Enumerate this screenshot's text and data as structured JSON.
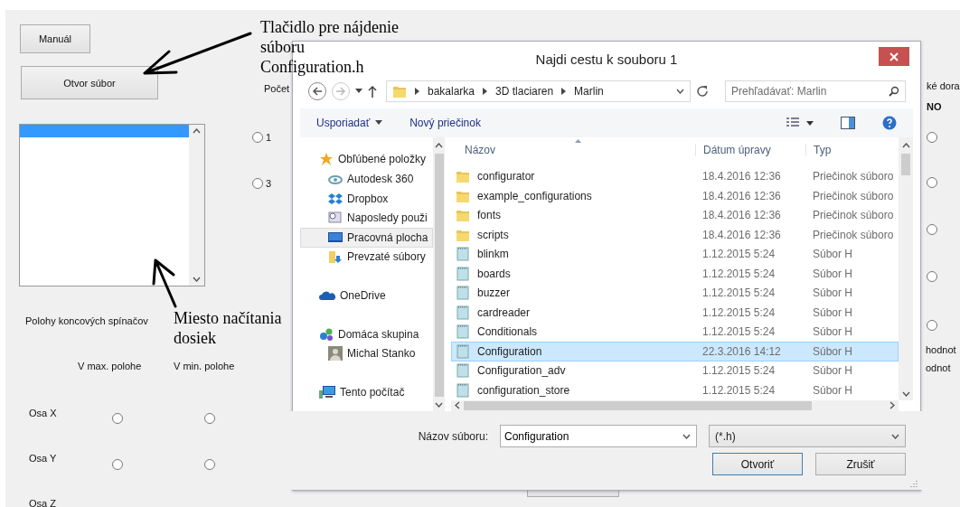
{
  "app": {
    "manual_button": "Manuál",
    "open_button": "Otvor súbor",
    "count_label": "Počet",
    "count_options": [
      {
        "label": "1",
        "selected": false
      },
      {
        "label": "3",
        "selected": false
      }
    ],
    "limit_title": "Polohy koncových spínačov",
    "limit_columns": [
      "V max. polohe",
      "V min. polohe"
    ],
    "axes": [
      {
        "label": "Osa X",
        "max_selected": false,
        "min_selected": false
      },
      {
        "label": "Osa Y",
        "max_selected": false,
        "min_selected": false
      },
      {
        "label": "Osa Z"
      }
    ],
    "right_heading": "ké dora",
    "right_column": "NO",
    "right_options": [
      {
        "selected": false
      },
      {
        "selected": false
      },
      {
        "selected": false
      },
      {
        "selected": false
      },
      {
        "selected": false
      }
    ],
    "right_labels": [
      "hodnot",
      "odnot"
    ]
  },
  "annotations": [
    {
      "lines": [
        "Tlačidlo pre nájdenie",
        "súboru",
        "Configuration.h"
      ]
    },
    {
      "lines": [
        "Miesto načítania",
        "dosiek"
      ]
    }
  ],
  "dialog": {
    "title": "Najdi cestu k souboru 1",
    "nav_buttons": [
      {
        "kind": "back",
        "disabled": false
      },
      {
        "kind": "forward",
        "disabled": true
      }
    ],
    "path": [
      "bakalarka",
      "3D tlaciaren",
      "Marlin"
    ],
    "search": {
      "placeholder": "Prehľadávať: Marlin"
    },
    "toolbar": [
      {
        "label": "Usporiadať",
        "dropdown": true
      },
      {
        "label": "Nový priečinok",
        "dropdown": false
      }
    ],
    "nav": [
      {
        "label": "Obľúbené položky",
        "kind": "favorites",
        "selected": false,
        "children": [
          {
            "label": "Autodesk 360",
            "kind": "cloud",
            "selected": false
          },
          {
            "label": "Dropbox",
            "kind": "box",
            "selected": false
          },
          {
            "label": "Naposledy použi",
            "kind": "recent",
            "selected": false
          },
          {
            "label": "Pracovná plocha",
            "kind": "desktop",
            "selected": true
          },
          {
            "label": "Prevzaté súbory",
            "kind": "downloads",
            "selected": false
          }
        ]
      },
      {
        "label": "OneDrive",
        "kind": "onedrive",
        "selected": false
      },
      {
        "label": "Domáca skupina",
        "kind": "homegroup",
        "selected": false,
        "children": [
          {
            "label": "Michal Stanko",
            "kind": "user",
            "selected": false
          }
        ]
      },
      {
        "label": "Tento počítač",
        "kind": "computer",
        "selected": false
      }
    ],
    "columns": [
      "Názov",
      "Dátum úpravy",
      "Typ"
    ],
    "files": [
      {
        "name": "configurator",
        "date": "18.4.2016 12:36",
        "type": "Priečinok súboro",
        "kind": "folder",
        "selected": false
      },
      {
        "name": "example_configurations",
        "date": "18.4.2016 12:36",
        "type": "Priečinok súboro",
        "kind": "folder",
        "selected": false
      },
      {
        "name": "fonts",
        "date": "18.4.2016 12:36",
        "type": "Priečinok súboro",
        "kind": "folder",
        "selected": false
      },
      {
        "name": "scripts",
        "date": "18.4.2016 12:36",
        "type": "Priečinok súboro",
        "kind": "folder",
        "selected": false
      },
      {
        "name": "blinkm",
        "date": "1.12.2015 5:24",
        "type": "Súbor H",
        "kind": "file",
        "selected": false
      },
      {
        "name": "boards",
        "date": "1.12.2015 5:24",
        "type": "Súbor H",
        "kind": "file",
        "selected": false
      },
      {
        "name": "buzzer",
        "date": "1.12.2015 5:24",
        "type": "Súbor H",
        "kind": "file",
        "selected": false
      },
      {
        "name": "cardreader",
        "date": "1.12.2015 5:24",
        "type": "Súbor H",
        "kind": "file",
        "selected": false
      },
      {
        "name": "Conditionals",
        "date": "1.12.2015 5:24",
        "type": "Súbor H",
        "kind": "file",
        "selected": false
      },
      {
        "name": "Configuration",
        "date": "22.3.2016 14:12",
        "type": "Súbor H",
        "kind": "file",
        "selected": true
      },
      {
        "name": "Configuration_adv",
        "date": "1.12.2015 5:24",
        "type": "Súbor H",
        "kind": "file",
        "selected": false
      },
      {
        "name": "configuration_store",
        "date": "1.12.2015 5:24",
        "type": "Súbor H",
        "kind": "file",
        "selected": false
      }
    ],
    "filename_label": "Názov súboru:",
    "filename": "Configuration",
    "filter": "(*.h)",
    "buttons": [
      {
        "label": "Otvoriť",
        "default": true
      },
      {
        "label": "Zrušiť",
        "default": false
      }
    ]
  }
}
